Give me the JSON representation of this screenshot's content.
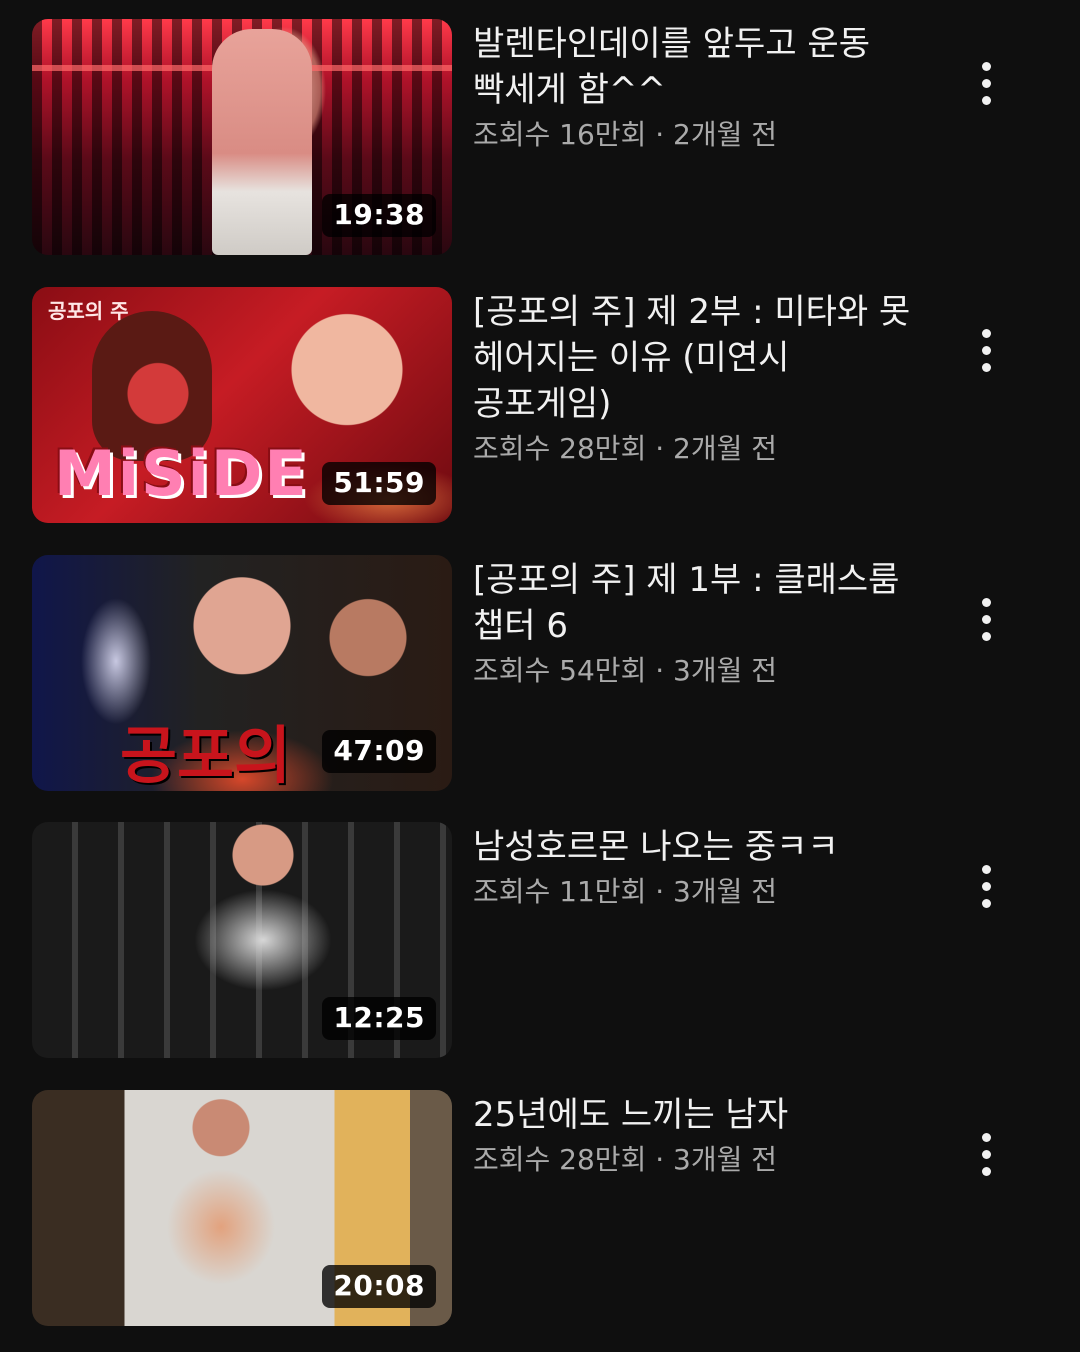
{
  "videos": [
    {
      "title": "발렌타인데이를 앞두고 운동 빡세게 함^^",
      "views": "조회수 16만회",
      "age": "2개월 전",
      "duration": "19:38",
      "thumb_icon": "thumbnail-shirtless-gym-red-light"
    },
    {
      "title": "[공포의 주] 제 2부 : 미타와 못 헤어지는 이유 (미연시 공포게임)",
      "views": "조회수 28만회",
      "age": "2개월 전",
      "duration": "51:59",
      "thumb_text": "MiSiDE",
      "thumb_tag": "공포의 주",
      "thumb_icon": "thumbnail-miside-game"
    },
    {
      "title": "[공포의 주] 제 1부 : 클래스룸 챕터 6",
      "views": "조회수 54만회",
      "age": "3개월 전",
      "duration": "47:09",
      "thumb_text": "공포의",
      "thumb_icon": "thumbnail-horror-classroom"
    },
    {
      "title": "남성호르몬 나오는 중ㅋㅋ",
      "views": "조회수 11만회",
      "age": "3개월 전",
      "duration": "12:25",
      "thumb_icon": "thumbnail-pushups-gym"
    },
    {
      "title": "25년에도 느끼는 남자",
      "views": "조회수 28만회",
      "age": "3개월 전",
      "duration": "20:08",
      "thumb_icon": "thumbnail-kitchen-shirtless"
    }
  ],
  "separator": " · ",
  "colors": {
    "background": "#0f0f0f",
    "title": "#f1f1f1",
    "meta": "#aaaaaa"
  }
}
